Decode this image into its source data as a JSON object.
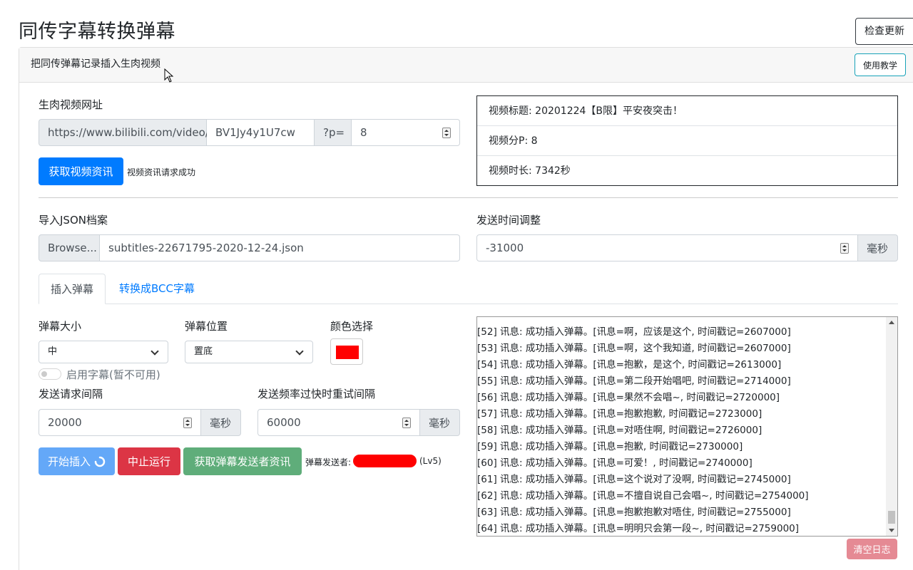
{
  "app": {
    "title": "同传字幕转换弹幕",
    "check_update": "检查更新"
  },
  "card": {
    "header_title": "把同传弹幕记录插入生肉视频",
    "tutorial": "使用教学"
  },
  "video": {
    "label": "生肉视频网址",
    "url_prefix": "https://www.bilibili.com/video/",
    "bvid": "BV1Jy4y1U7cw",
    "p_label": "?p=",
    "p_value": "8",
    "fetch_button": "获取视频资讯",
    "fetch_status": "视频资讯请求成功"
  },
  "info": {
    "title": "视频标题: 20201224【B限】平安夜突击！",
    "parts": "视频分P: 8",
    "duration": "视频时长: 7342秒"
  },
  "json_import": {
    "label": "导入JSON档案",
    "browse": "Browse...",
    "filename": "subtitles-22671795-2020-12-24.json"
  },
  "time_adjust": {
    "label": "发送时间调整",
    "value": "-31000",
    "unit": "毫秒"
  },
  "tabs": [
    {
      "label": "插入弹幕",
      "active": true
    },
    {
      "label": "转换成BCC字幕",
      "active": false
    }
  ],
  "options": {
    "size_label": "弹幕大小",
    "size_value": "中",
    "position_label": "弹幕位置",
    "position_value": "置底",
    "color_label": "颜色选择",
    "color_value": "#ff0000",
    "subtitle_toggle": "启用字幕(暂不可用)"
  },
  "interval": {
    "label": "发送请求间隔",
    "value": "20000",
    "unit": "毫秒"
  },
  "retry": {
    "label": "发送频率过快时重试间隔",
    "value": "60000",
    "unit": "毫秒"
  },
  "actions": {
    "start": "开始插入",
    "stop": "中止运行",
    "fetch_sender": "获取弹幕发送者资讯",
    "sender_label": "弹幕发送者:",
    "sender_level": "(Lv5)"
  },
  "log": {
    "lines": [
      "[52] 讯息: 成功插入弹幕。[讯息=啊，应该是这个, 时间戳记=2607000]",
      "[53] 讯息: 成功插入弹幕。[讯息=啊，这个我知道, 时间戳记=2607000]",
      "[54] 讯息: 成功插入弹幕。[讯息=抱歉，是这个, 时间戳记=2613000]",
      "[55] 讯息: 成功插入弹幕。[讯息=第二段开始唱吧, 时间戳记=2714000]",
      "[56] 讯息: 成功插入弹幕。[讯息=果然不会唱~, 时间戳记=2720000]",
      "[57] 讯息: 成功插入弹幕。[讯息=抱歉抱歉, 时间戳记=2723000]",
      "[58] 讯息: 成功插入弹幕。[讯息=对唔住啊, 时间戳记=2726000]",
      "[59] 讯息: 成功插入弹幕。[讯息=抱歉, 时间戳记=2730000]",
      "[60] 讯息: 成功插入弹幕。[讯息=可爱！, 时间戳记=2740000]",
      "[61] 讯息: 成功插入弹幕。[讯息=这个说对了没啊, 时间戳记=2745000]",
      "[62] 讯息: 成功插入弹幕。[讯息=不擅自说自己会唱~, 时间戳记=2754000]",
      "[63] 讯息: 成功插入弹幕。[讯息=抱歉抱歉对唔住, 时间戳记=2755000]",
      "[64] 讯息: 成功插入弹幕。[讯息=明明只会第一段~, 时间戳记=2759000]"
    ],
    "clear": "清空日志"
  }
}
